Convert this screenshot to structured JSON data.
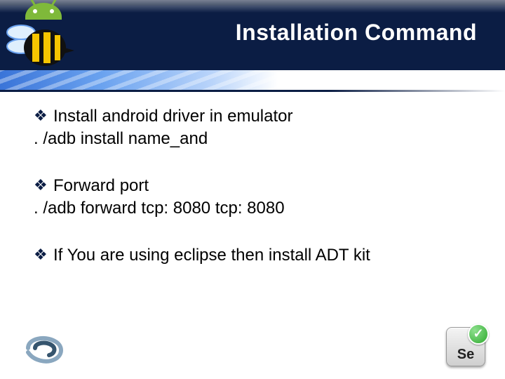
{
  "title": "Installation Command",
  "blocks": [
    {
      "bullet": "Install android driver in emulator",
      "plain": ". /adb install name_and"
    },
    {
      "bullet": "Forward port",
      "plain": ". /adb forward tcp: 8080 tcp: 8080"
    },
    {
      "bullet": "If You are using eclipse then install ADT kit",
      "plain": ""
    }
  ],
  "se_label": "Se"
}
